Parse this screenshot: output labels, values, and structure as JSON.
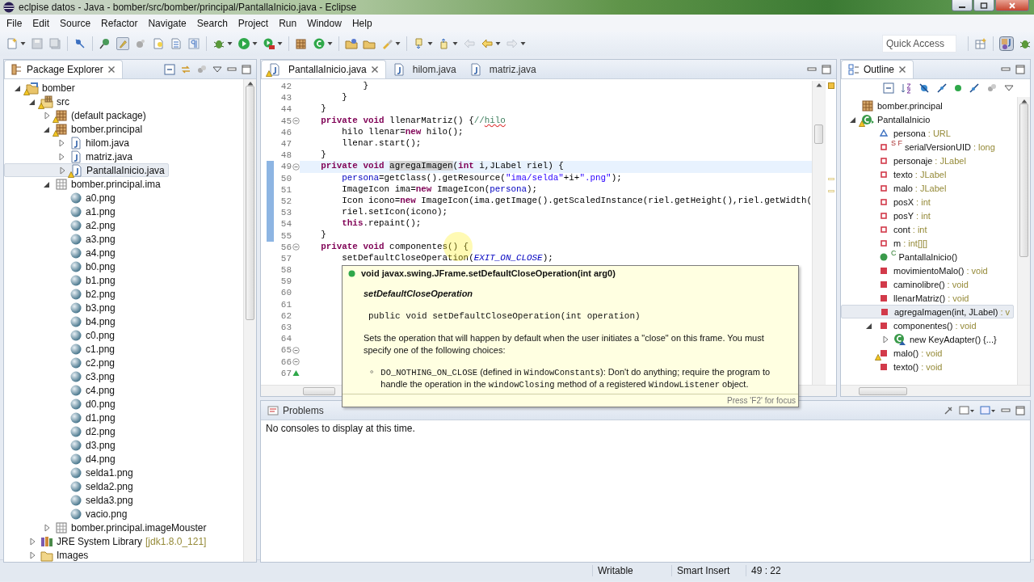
{
  "window": {
    "title": "eclpise datos - Java - bomber/src/bomber/principal/PantallaInicio.java - Eclipse"
  },
  "menu": [
    "File",
    "Edit",
    "Source",
    "Refactor",
    "Navigate",
    "Search",
    "Project",
    "Run",
    "Window",
    "Help"
  ],
  "quick_access": {
    "placeholder": "Quick Access"
  },
  "package_explorer": {
    "title": "Package Explorer",
    "tree": [
      {
        "label": "bomber",
        "kind": "project",
        "warning": true,
        "selected": false,
        "expanded": true,
        "children": [
          {
            "label": "src",
            "kind": "srcfolder",
            "warning": true,
            "selected": false,
            "expanded": true,
            "children": [
              {
                "label": "(default package)",
                "kind": "package",
                "warning": true,
                "selected": false,
                "expanded": false
              },
              {
                "label": "bomber.principal",
                "kind": "package",
                "warning": true,
                "selected": false,
                "expanded": true,
                "children": [
                  {
                    "label": "hilom.java",
                    "kind": "javafile",
                    "warning": false,
                    "selected": false,
                    "expanded": false
                  },
                  {
                    "label": "matriz.java",
                    "kind": "javafile",
                    "warning": false,
                    "selected": false,
                    "expanded": false
                  },
                  {
                    "label": "PantallaInicio.java",
                    "kind": "javafile",
                    "warning": true,
                    "selected": true,
                    "expanded": false
                  }
                ]
              },
              {
                "label": "bomber.principal.ima",
                "kind": "emptypackage",
                "warning": false,
                "selected": false,
                "expanded": true,
                "children": [
                  {
                    "label": "a0.png",
                    "kind": "image",
                    "warning": false,
                    "selected": false
                  },
                  {
                    "label": "a1.png",
                    "kind": "image",
                    "warning": false,
                    "selected": false
                  },
                  {
                    "label": "a2.png",
                    "kind": "image",
                    "warning": false,
                    "selected": false
                  },
                  {
                    "label": "a3.png",
                    "kind": "image",
                    "warning": false,
                    "selected": false
                  },
                  {
                    "label": "a4.png",
                    "kind": "image",
                    "warning": false,
                    "selected": false
                  },
                  {
                    "label": "b0.png",
                    "kind": "image",
                    "warning": false,
                    "selected": false
                  },
                  {
                    "label": "b1.png",
                    "kind": "image",
                    "warning": false,
                    "selected": false
                  },
                  {
                    "label": "b2.png",
                    "kind": "image",
                    "warning": false,
                    "selected": false
                  },
                  {
                    "label": "b3.png",
                    "kind": "image",
                    "warning": false,
                    "selected": false
                  },
                  {
                    "label": "b4.png",
                    "kind": "image",
                    "warning": false,
                    "selected": false
                  },
                  {
                    "label": "c0.png",
                    "kind": "image",
                    "warning": false,
                    "selected": false
                  },
                  {
                    "label": "c1.png",
                    "kind": "image",
                    "warning": false,
                    "selected": false
                  },
                  {
                    "label": "c2.png",
                    "kind": "image",
                    "warning": false,
                    "selected": false
                  },
                  {
                    "label": "c3.png",
                    "kind": "image",
                    "warning": false,
                    "selected": false
                  },
                  {
                    "label": "c4.png",
                    "kind": "image",
                    "warning": false,
                    "selected": false
                  },
                  {
                    "label": "d0.png",
                    "kind": "image",
                    "warning": false,
                    "selected": false
                  },
                  {
                    "label": "d1.png",
                    "kind": "image",
                    "warning": false,
                    "selected": false
                  },
                  {
                    "label": "d2.png",
                    "kind": "image",
                    "warning": false,
                    "selected": false
                  },
                  {
                    "label": "d3.png",
                    "kind": "image",
                    "warning": false,
                    "selected": false
                  },
                  {
                    "label": "d4.png",
                    "kind": "image",
                    "warning": false,
                    "selected": false
                  },
                  {
                    "label": "selda1.png",
                    "kind": "image",
                    "warning": false,
                    "selected": false
                  },
                  {
                    "label": "selda2.png",
                    "kind": "image",
                    "warning": false,
                    "selected": false
                  },
                  {
                    "label": "selda3.png",
                    "kind": "image",
                    "warning": false,
                    "selected": false
                  },
                  {
                    "label": "vacio.png",
                    "kind": "image",
                    "warning": false,
                    "selected": false
                  }
                ]
              },
              {
                "label": "bomber.principal.imageMouster",
                "kind": "emptypackage",
                "warning": false,
                "selected": false,
                "expanded": false
              }
            ]
          },
          {
            "label": "JRE System Library",
            "detail": "[jdk1.8.0_121]",
            "kind": "library",
            "warning": false,
            "selected": false,
            "expanded": false
          },
          {
            "label": "Images",
            "kind": "folder",
            "warning": false,
            "selected": false,
            "expanded": false
          }
        ]
      }
    ]
  },
  "editor": {
    "tabs": [
      {
        "label": "PantallaInicio.java",
        "selected": true,
        "warning": true
      },
      {
        "label": "hilom.java",
        "selected": false,
        "warning": false
      },
      {
        "label": "matriz.java",
        "selected": false,
        "warning": false
      }
    ],
    "lines": [
      {
        "number": "42",
        "code": [
          {
            "kind": "plain",
            "text": "            }"
          }
        ],
        "changed": false,
        "current": false
      },
      {
        "number": "43",
        "code": [
          {
            "kind": "plain",
            "text": "        }"
          }
        ],
        "changed": false,
        "current": false
      },
      {
        "number": "44",
        "code": [
          {
            "kind": "plain",
            "text": "    }"
          }
        ],
        "changed": false,
        "current": false
      },
      {
        "number": "45",
        "code": [
          {
            "kind": "keyword",
            "text": "    private void"
          },
          {
            "kind": "plain",
            "text": " llenarMatriz() {"
          },
          {
            "kind": "comment",
            "text": "//"
          },
          {
            "kind": "misspelled",
            "text": "hilo"
          }
        ],
        "fold_open": true,
        "changed": false,
        "current": false
      },
      {
        "number": "46",
        "code": [
          {
            "kind": "plain",
            "text": "        hilo llenar="
          },
          {
            "kind": "keyword",
            "text": "new"
          },
          {
            "kind": "plain",
            "text": " hilo();"
          }
        ],
        "changed": false,
        "current": false
      },
      {
        "number": "47",
        "code": [
          {
            "kind": "plain",
            "text": "        llenar.start();"
          }
        ],
        "changed": false,
        "current": false
      },
      {
        "number": "48",
        "code": [
          {
            "kind": "plain",
            "text": "    }"
          }
        ],
        "changed": false,
        "current": false
      },
      {
        "number": "49",
        "code": [
          {
            "kind": "keyword",
            "text": "    private void "
          },
          {
            "kind": "occurrence",
            "text": "agregaImagen"
          },
          {
            "kind": "plain",
            "text": "("
          },
          {
            "kind": "keyword",
            "text": "int"
          },
          {
            "kind": "plain",
            "text": " i,JLabel riel) {"
          }
        ],
        "fold_open": true,
        "changed": true,
        "current": true
      },
      {
        "number": "50",
        "code": [
          {
            "kind": "field",
            "text": "        persona"
          },
          {
            "kind": "plain",
            "text": "=getClass().getResource("
          },
          {
            "kind": "string",
            "text": "\"ima/selda\""
          },
          {
            "kind": "plain",
            "text": "+i+"
          },
          {
            "kind": "string",
            "text": "\".png\""
          },
          {
            "kind": "plain",
            "text": ");"
          }
        ],
        "changed": true,
        "current": false
      },
      {
        "number": "51",
        "code": [
          {
            "kind": "plain",
            "text": "        ImageIcon ima="
          },
          {
            "kind": "keyword",
            "text": "new"
          },
          {
            "kind": "plain",
            "text": " ImageIcon("
          },
          {
            "kind": "field",
            "text": "persona"
          },
          {
            "kind": "plain",
            "text": ");"
          }
        ],
        "changed": true,
        "current": false
      },
      {
        "number": "52",
        "code": [
          {
            "kind": "plain",
            "text": "        Icon icono="
          },
          {
            "kind": "keyword",
            "text": "new"
          },
          {
            "kind": "plain",
            "text": " ImageIcon(ima.getImage().getScaledInstance(riel.getHeight(),riel.getWidth("
          }
        ],
        "changed": true,
        "current": false
      },
      {
        "number": "53",
        "code": [
          {
            "kind": "plain",
            "text": "        riel.setIcon(icono);"
          }
        ],
        "changed": true,
        "current": false
      },
      {
        "number": "54",
        "code": [
          {
            "kind": "keyword",
            "text": "        this"
          },
          {
            "kind": "plain",
            "text": ".repaint();"
          }
        ],
        "changed": true,
        "current": false
      },
      {
        "number": "55",
        "code": [
          {
            "kind": "plain",
            "text": "    }"
          }
        ],
        "changed": true,
        "current": false
      },
      {
        "number": "56",
        "code": [
          {
            "kind": "keyword",
            "text": "    private void"
          },
          {
            "kind": "plain",
            "text": " componentes() {"
          }
        ],
        "fold_open": true,
        "changed": false,
        "current": false
      },
      {
        "number": "57",
        "code": [
          {
            "kind": "plain",
            "text": "        setDefaultCloseOperation("
          },
          {
            "kind": "constant",
            "text": "EXIT_ON_CLOSE"
          },
          {
            "kind": "plain",
            "text": ");"
          }
        ],
        "changed": false,
        "current": false
      },
      {
        "number": "58",
        "changed": false,
        "current": false
      },
      {
        "number": "59",
        "changed": false,
        "current": false
      },
      {
        "number": "60",
        "changed": false,
        "current": false
      },
      {
        "number": "61",
        "changed": false,
        "current": false
      },
      {
        "number": "62",
        "changed": false,
        "current": false
      },
      {
        "number": "63",
        "changed": false,
        "current": false
      },
      {
        "number": "64",
        "changed": false,
        "current": false
      },
      {
        "number": "65",
        "fold_open": true,
        "changed": false,
        "current": false
      },
      {
        "number": "66",
        "fold_open": true,
        "changed": false,
        "current": false
      },
      {
        "number": "67",
        "overrides": true,
        "changed": false,
        "current": false
      }
    ]
  },
  "hover": {
    "header": "void javax.swing.JFrame.setDefaultCloseOperation(int arg0)",
    "title": "setDefaultCloseOperation",
    "signature": "public void setDefaultCloseOperation(int operation)",
    "description": "Sets the operation that will happen by default when the user initiates a \"close\" on this frame. You must specify one of the following choices:",
    "items": [
      [
        {
          "mono": true,
          "text": "DO_NOTHING_ON_CLOSE"
        },
        {
          "mono": false,
          "text": " (defined in "
        },
        {
          "mono": true,
          "text": "WindowConstants"
        },
        {
          "mono": false,
          "text": "): Don't do anything; require the program to handle the operation in the "
        },
        {
          "mono": true,
          "text": "windowClosing"
        },
        {
          "mono": false,
          "text": " method of a registered "
        },
        {
          "mono": true,
          "text": "WindowListener"
        },
        {
          "mono": false,
          "text": " object."
        }
      ]
    ],
    "footer": "Press 'F2' for focus"
  },
  "outline": {
    "title": "Outline",
    "tree": [
      {
        "label": "bomber.principal",
        "kind": "package",
        "warning": false,
        "selected": false
      },
      {
        "label": "PantallaInicio",
        "kind": "class",
        "warning": true,
        "selected": false,
        "expanded": true,
        "children": [
          {
            "label": "persona",
            "type": ": URL",
            "kind": "field-default",
            "warning": false,
            "selected": false
          },
          {
            "label": "serialVersionUID",
            "decorator": "S F",
            "type": ": long",
            "kind": "field-private",
            "warning": false,
            "selected": false
          },
          {
            "label": "personaje",
            "type": ": JLabel",
            "kind": "field-private",
            "warning": false,
            "selected": false
          },
          {
            "label": "texto",
            "type": ": JLabel",
            "kind": "field-private",
            "warning": false,
            "selected": false
          },
          {
            "label": "malo",
            "type": ": JLabel",
            "kind": "field-private",
            "warning": false,
            "selected": false
          },
          {
            "label": "posX",
            "type": ": int",
            "kind": "field-private",
            "warning": false,
            "selected": false
          },
          {
            "label": "posY",
            "type": ": int",
            "kind": "field-private",
            "warning": false,
            "selected": false
          },
          {
            "label": "cont",
            "type": ": int",
            "kind": "field-private",
            "warning": false,
            "selected": false
          },
          {
            "label": "m",
            "type": ": int[][]",
            "kind": "field-private",
            "warning": false,
            "selected": false
          },
          {
            "label": "PantallaInicio()",
            "decorator": "C",
            "kind": "constructor",
            "warning": false,
            "selected": false
          },
          {
            "label": "movimientoMalo()",
            "type": ": void",
            "kind": "method-private",
            "warning": false,
            "selected": false
          },
          {
            "label": "caminolibre()",
            "type": ": void",
            "kind": "method-private",
            "warning": false,
            "selected": false
          },
          {
            "label": "llenarMatriz()",
            "type": ": void",
            "kind": "method-private",
            "warning": false,
            "selected": false
          },
          {
            "label": "agregaImagen(int, JLabel)",
            "type": ": v",
            "kind": "method-private",
            "warning": false,
            "selected": true
          },
          {
            "label": "componentes()",
            "type": ": void",
            "kind": "method-private",
            "warning": false,
            "selected": false,
            "expanded": true,
            "children": [
              {
                "label": "new KeyAdapter() {...}",
                "kind": "anon",
                "warning": false,
                "selected": false,
                "expanded": false
              }
            ]
          },
          {
            "label": "malo()",
            "type": ": void",
            "kind": "method-private",
            "warning": true,
            "selected": false
          },
          {
            "label": "texto()",
            "type": ": void",
            "kind": "method-private",
            "warning": false,
            "selected": false
          }
        ]
      }
    ]
  },
  "console": {
    "tabs": [
      {
        "label": "Problems",
        "selected": false
      }
    ],
    "message": "No consoles to display at this time."
  },
  "status_bar": [
    "Writable",
    "Smart Insert",
    "49 : 22"
  ]
}
